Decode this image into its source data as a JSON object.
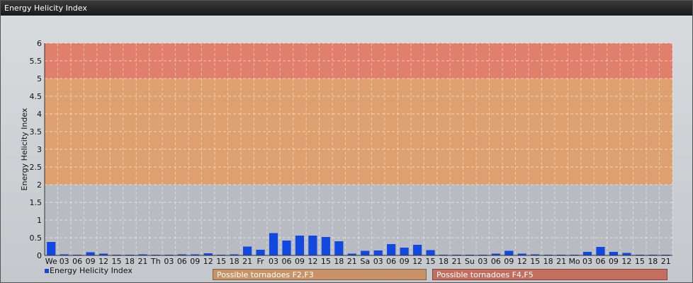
{
  "window": {
    "title": "Energy Helicity Index"
  },
  "chart_data": {
    "type": "bar",
    "ylabel": "Energy Helicity Index",
    "ylim": [
      0,
      6
    ],
    "yticks": [
      "0",
      "0.5",
      "1",
      "1.5",
      "2",
      "2.5",
      "3",
      "3.5",
      "4",
      "4.5",
      "5",
      "5.5",
      "6"
    ],
    "grid": true,
    "bands": [
      {
        "from": 0,
        "to": 2,
        "color": "#b8bcc2"
      },
      {
        "from": 2,
        "to": 5,
        "color": "#dea06e"
      },
      {
        "from": 5,
        "to": 6,
        "color": "#e07f6c"
      }
    ],
    "categories": [
      "We",
      "03",
      "06",
      "09",
      "12",
      "15",
      "18",
      "21",
      "Th",
      "03",
      "06",
      "09",
      "12",
      "15",
      "18",
      "21",
      "Fr",
      "03",
      "06",
      "09",
      "12",
      "15",
      "18",
      "21",
      "Sa",
      "03",
      "06",
      "09",
      "12",
      "15",
      "18",
      "21",
      "Su",
      "03",
      "06",
      "09",
      "12",
      "15",
      "18",
      "21",
      "Mo",
      "03",
      "06",
      "09",
      "12",
      "15",
      "18",
      "21"
    ],
    "series": [
      {
        "name": "Energy Helicity Index",
        "color": "#1048e0",
        "values": [
          0.38,
          0.03,
          0.02,
          0.09,
          0.05,
          0.02,
          0.02,
          0.03,
          0.02,
          0.02,
          0.03,
          0.03,
          0.06,
          0.02,
          0.03,
          0.25,
          0.16,
          0.63,
          0.42,
          0.56,
          0.56,
          0.52,
          0.4,
          0.05,
          0.13,
          0.14,
          0.32,
          0.22,
          0.3,
          0.15,
          0.02,
          0.02,
          0.02,
          0.02,
          0.05,
          0.13,
          0.05,
          0.03,
          0.02,
          0.02,
          0.02,
          0.1,
          0.24,
          0.1,
          0.07,
          0.02,
          0.02,
          0.02
        ]
      }
    ],
    "legend": [
      {
        "label": "Possible tornadoes F2,F3",
        "color": "#c89467"
      },
      {
        "label": "Possible tornadoes F4,F5",
        "color": "#c46e60"
      }
    ],
    "legend_placement": "bottom"
  }
}
